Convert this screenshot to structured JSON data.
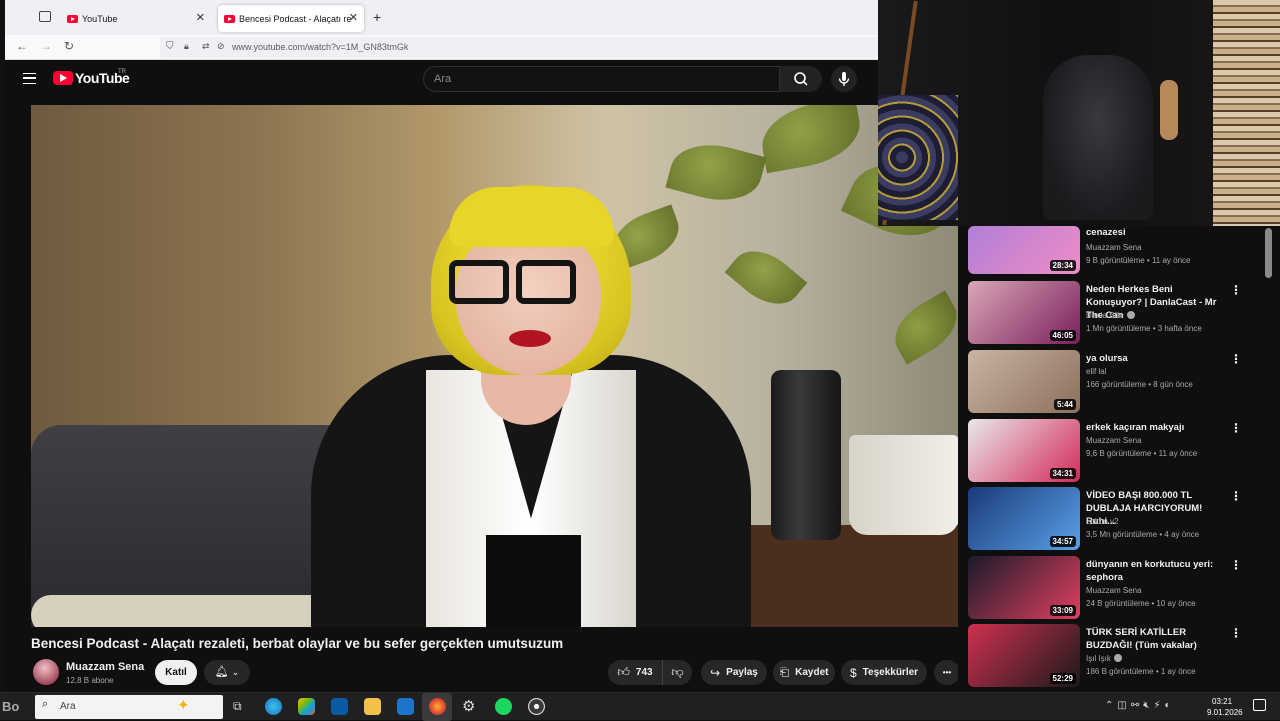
{
  "browser": {
    "tabs": [
      {
        "label": "YouTube",
        "active": false
      },
      {
        "label": "Bencesi Podcast - Alaçatı rezalet",
        "active": true
      }
    ],
    "new_tab_glyph": "+",
    "url": "www.youtube.com/watch?v=1M_GN83tmGk"
  },
  "youtube": {
    "logo_text": "YouTube",
    "region": "TR",
    "search_placeholder": "Ara"
  },
  "video": {
    "title": "Bencesi Podcast - Alaçatı rezaleti, berbat olaylar ve bu sefer gerçekten umutsuzum",
    "channel": "Muazzam Sena",
    "subscribers": "12,8 B abone",
    "join_label": "Katıl",
    "likes": "743",
    "share_label": "Paylaş",
    "save_label": "Kaydet",
    "thanks_label": "Teşekkürler",
    "more_glyph": "•••"
  },
  "recommendations": [
    {
      "title": "cenazesi",
      "channel": "Muazzam Sena",
      "verified": false,
      "meta": "9 B görüntüleme • 11 ay önce",
      "duration": "28:34",
      "thumb_colors": [
        "#b07fd6",
        "#f08cc7"
      ]
    },
    {
      "title": "Neden Herkes Beni Konuşuyor? | DanlaCast - Mr The Can",
      "channel": "Danla Bilic",
      "verified": true,
      "meta": "1 Mn görüntüleme • 3 hafta önce",
      "duration": "46:05",
      "thumb_colors": [
        "#d8a7b6",
        "#7a1f5c"
      ]
    },
    {
      "title": "ya olursa",
      "channel": "elif lal",
      "verified": false,
      "meta": "166 görüntüleme • 8 gün önce",
      "duration": "5:44",
      "thumb_colors": [
        "#c9b5a3",
        "#8b6f5c"
      ]
    },
    {
      "title": "erkek kaçıran makyajı",
      "channel": "Muazzam Sena",
      "verified": false,
      "meta": "9,6 B görüntüleme • 11 ay önce",
      "duration": "34:31",
      "thumb_colors": [
        "#e8e8ea",
        "#d32a5a"
      ]
    },
    {
      "title": "VİDEO BAŞI 800.000 TL DUBLAJA HARCIYORUM! Ruhi...",
      "channel": "Orkun v2",
      "verified": false,
      "meta": "3,5 Mn görüntüleme • 4 ay önce",
      "duration": "34:57",
      "thumb_colors": [
        "#1a3a7a",
        "#5aa0e6"
      ]
    },
    {
      "title": "dünyanın en korkutucu yeri: sephora",
      "channel": "Muazzam Sena",
      "verified": false,
      "meta": "24 B görüntüleme • 10 ay önce",
      "duration": "33:09",
      "thumb_colors": [
        "#1a1a2a",
        "#e04060"
      ]
    },
    {
      "title": "TÜRK SERİ KATİLLER BUZDAĞI! (Tüm vakalar)",
      "channel": "Işıl Işık",
      "verified": true,
      "meta": "186 B görüntüleme • 1 ay önce",
      "duration": "52:29",
      "thumb_colors": [
        "#d03050",
        "#1a1a1a"
      ]
    }
  ],
  "taskbar": {
    "search_placeholder": "Ara",
    "watermark": "Bo",
    "time": "03:21",
    "date": "9.01.2026"
  },
  "colors": {
    "youtube_red": "#ff0033",
    "background": "#0f0f0f"
  }
}
